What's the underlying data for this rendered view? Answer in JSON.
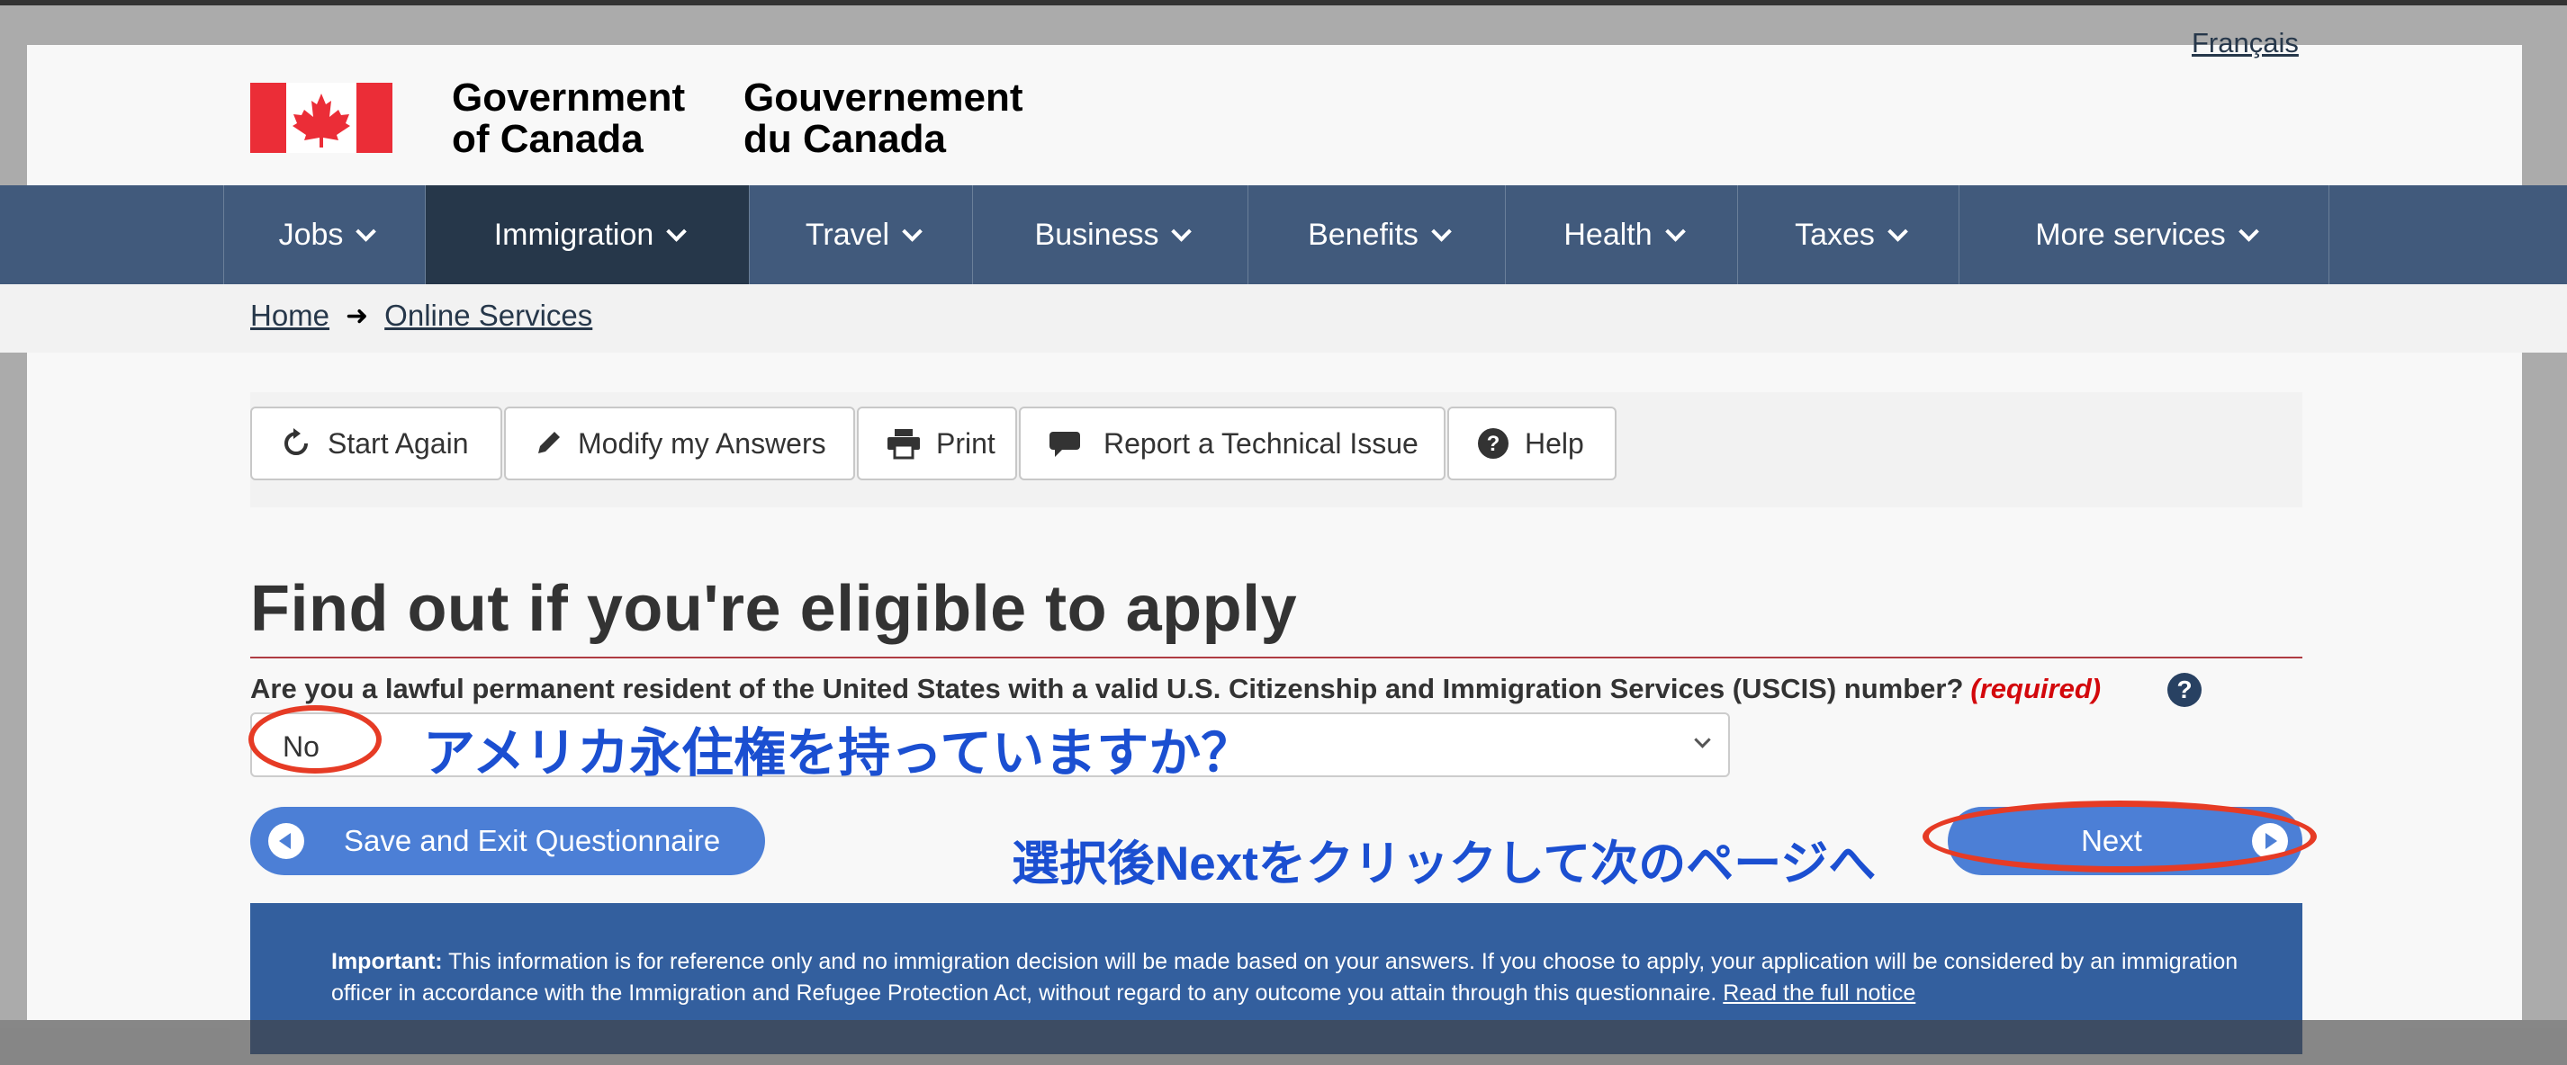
{
  "header": {
    "language_link": "Français",
    "brand_en_line1": "Government",
    "brand_en_line2": "of Canada",
    "brand_fr_line1": "Gouvernement",
    "brand_fr_line2": "du Canada"
  },
  "nav": {
    "items": [
      {
        "label": "Jobs"
      },
      {
        "label": "Immigration"
      },
      {
        "label": "Travel"
      },
      {
        "label": "Business"
      },
      {
        "label": "Benefits"
      },
      {
        "label": "Health"
      },
      {
        "label": "Taxes"
      },
      {
        "label": "More services"
      }
    ]
  },
  "breadcrumb": {
    "home": "Home",
    "online_services": "Online Services"
  },
  "toolbar": {
    "start_again": "Start Again",
    "modify": "Modify my Answers",
    "print": "Print",
    "report": "Report a Technical Issue",
    "help": "Help"
  },
  "main": {
    "title": "Find out if you're eligible to apply",
    "question": "Are you a lawful permanent resident of the United States with a valid U.S. Citizenship and Immigration Services (USCIS) number?",
    "required": "(required)",
    "help_icon": "?",
    "selected_answer": "No"
  },
  "actions": {
    "save_exit": "Save and Exit Questionnaire",
    "next": "Next"
  },
  "annotations": {
    "select_note": "アメリカ永住権を持っていますか？",
    "next_note": "選択後Nextをクリックして次のページへ",
    "color": "#1b4fd1",
    "ring_color": "#e63b25"
  },
  "notice": {
    "label": "Important:",
    "text": "This information is for reference only and no immigration decision will be made based on your answers. If you choose to apply, your application will be considered by an immigration officer in accordance with the Immigration and Refugee Protection Act, without regard to any outcome you attain through this questionnaire.",
    "link": "Read the full notice"
  },
  "colors": {
    "nav_bg": "#415a7c",
    "nav_active": "#26374a",
    "accent_red": "#af3c43",
    "button_blue": "#4c7fd6",
    "notice_bg": "#335f9e"
  }
}
